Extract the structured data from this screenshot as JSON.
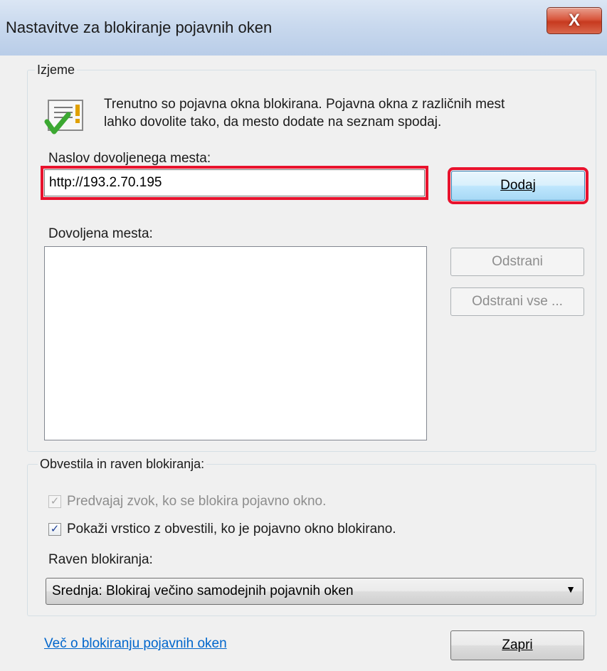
{
  "window": {
    "title": "Nastavitve za blokiranje pojavnih oken",
    "close_label": "X"
  },
  "exceptions": {
    "legend": "Izjeme",
    "info_line1": "Trenutno so pojavna okna blokirana. Pojavna okna z različnih mest",
    "info_line2": "lahko dovolite tako, da mesto dodate na seznam spodaj.",
    "address_label": "Naslov dovoljenega mesta:",
    "address_value": "http://193.2.70.195",
    "add_button": "Dodaj",
    "allowed_label": "Dovoljena mesta:",
    "allowed_items": [],
    "remove_button": "Odstrani",
    "remove_all_button": "Odstrani vse ..."
  },
  "notifications": {
    "legend": "Obvestila in raven blokiranja:",
    "play_sound": {
      "label": "Predvajaj zvok, ko se blokira pojavno okno.",
      "checked": true,
      "disabled": true
    },
    "show_bar": {
      "label": "Pokaži vrstico z obvestili, ko je pojavno okno blokirano.",
      "checked": true,
      "disabled": false
    },
    "level_label": "Raven blokiranja:",
    "level_value": "Srednja: Blokiraj večino samodejnih pojavnih oken"
  },
  "footer": {
    "learn_more_link": "Več o blokiranju pojavnih oken",
    "close_button": "Zapri"
  },
  "colors": {
    "highlight": "#e8122d",
    "link": "#0066cc"
  },
  "icons": {
    "info_icon": "document-checkmark-icon",
    "checkbox_mark": "✓",
    "dropdown": "chevron-down-icon"
  }
}
